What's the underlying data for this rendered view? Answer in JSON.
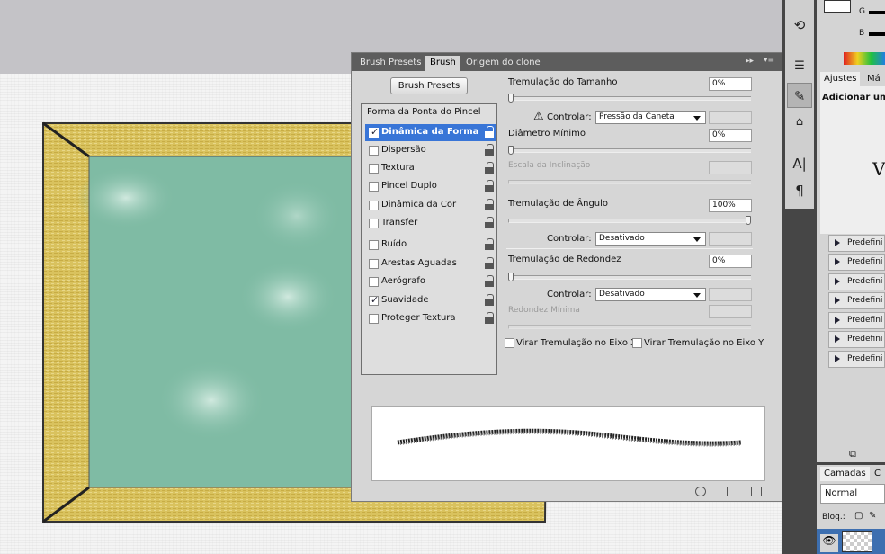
{
  "brush_panel": {
    "tabs": [
      "Brush Presets",
      "Brush",
      "Origem do clone"
    ],
    "presets_button": "Brush Presets",
    "options_header": "Forma da Ponta do Pincel",
    "options": [
      {
        "label": "Dinâmica da Forma",
        "checked": true,
        "selected": true
      },
      {
        "label": "Dispersão",
        "checked": false
      },
      {
        "label": "Textura",
        "checked": false
      },
      {
        "label": "Pincel Duplo",
        "checked": false
      },
      {
        "label": "Dinâmica da Cor",
        "checked": false
      },
      {
        "label": "Transfer",
        "checked": false
      },
      {
        "label": "Ruído",
        "checked": false
      },
      {
        "label": "Arestas Aguadas",
        "checked": false
      },
      {
        "label": "Aerógrafo",
        "checked": false
      },
      {
        "label": "Suavidade",
        "checked": true
      },
      {
        "label": "Proteger Textura",
        "checked": false
      }
    ],
    "size_jitter": {
      "label": "Tremulação do Tamanho",
      "value": "0%",
      "level": 0
    },
    "control_label": "Controlar:",
    "size_control": "Pressão da Caneta",
    "min_diameter": {
      "label": "Diâmetro Mínimo",
      "value": "0%",
      "level": 0
    },
    "tilt_scale": {
      "label": "Escala da Inclinação"
    },
    "angle_jitter": {
      "label": "Tremulação de Ângulo",
      "value": "100%",
      "level": 1
    },
    "angle_control": "Desativado",
    "roundness_jitter": {
      "label": "Tremulação de Redondez",
      "value": "0%",
      "level": 0
    },
    "roundness_control": "Desativado",
    "min_roundness": {
      "label": "Redondez Mínima"
    },
    "flip_x": "Virar Tremulação no Eixo X",
    "flip_y": "Virar Tremulação no Eixo Y"
  },
  "right_panel": {
    "color_labels": [
      "G",
      "B"
    ],
    "tabs": [
      "Ajustes",
      "Má"
    ],
    "add_adjustment": "Adicionar um",
    "preset_rows": [
      "Predefini",
      "Predefini",
      "Predefini",
      "Predefini",
      "Predefini",
      "Predefini",
      "Predefini"
    ],
    "layers_tabs": [
      "Camadas",
      "C"
    ],
    "blend_mode": "Normal",
    "lock_label": "Bloq.:"
  },
  "colors": {
    "selection": "#3875d7",
    "frame_gold": "#d9c25e",
    "canvas_teal": "#7fbba4"
  }
}
